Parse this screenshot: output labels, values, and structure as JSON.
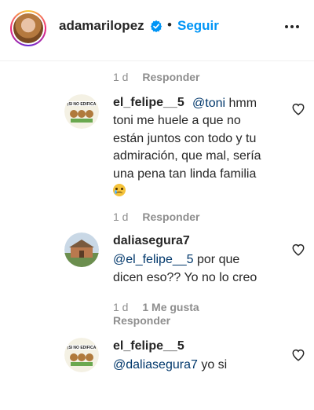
{
  "header": {
    "username": "adamarilopez",
    "separator": "•",
    "follow_label": "Seguir",
    "verified_icon": "verified-badge-icon",
    "more_icon": "more-options-icon"
  },
  "top_meta": {
    "time": "1 d",
    "reply_label": "Responder"
  },
  "comments": [
    {
      "username": "el_felipe__5",
      "mention": "@toni",
      "text_lines": [
        " hmm",
        "toni me huele a que no",
        "están juntos con todo y tu",
        "admiración, que mal, sería",
        "una pena tan linda familia"
      ],
      "emoji": "crying-face-emoji",
      "time": "1 d",
      "reply_label": "Responder",
      "avatar_text": "¡SI NO EDIFICA"
    },
    {
      "username": "daliasegura7",
      "mention": "@el_felipe__5",
      "text_lines": [
        " por que",
        "dicen eso?? Yo no lo creo"
      ],
      "time": "1 d",
      "likes_label": "1 Me gusta",
      "reply_label": "Responder"
    },
    {
      "username": "el_felipe__5",
      "mention": "@daliasegura7",
      "text_lines": [
        " yo si"
      ],
      "avatar_text": "¡SI NO EDIFICA"
    }
  ],
  "colors": {
    "accent": "#0095f6",
    "mention": "#00376b",
    "meta": "#8e8e8e"
  }
}
